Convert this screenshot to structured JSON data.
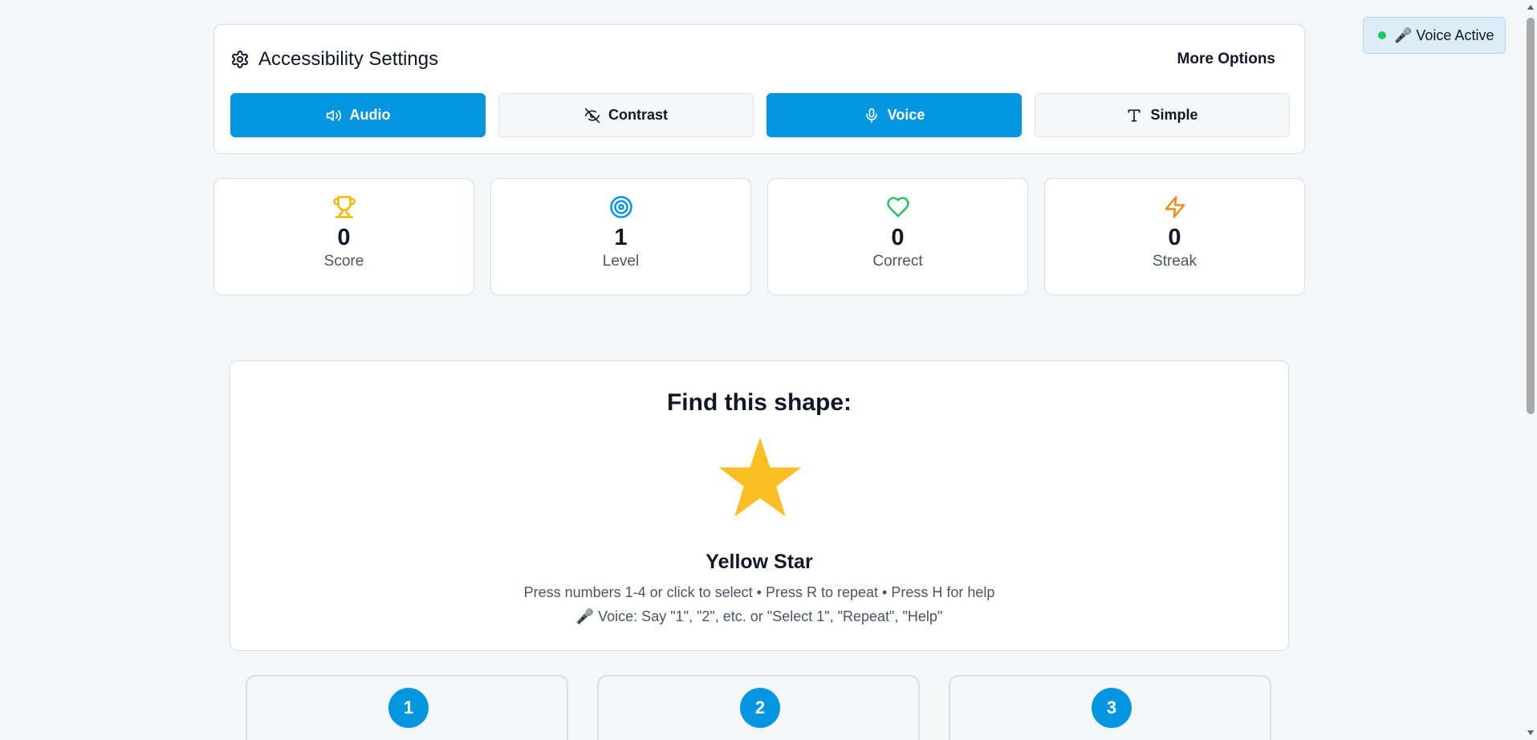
{
  "settings": {
    "title": "Accessibility Settings",
    "more_options": "More Options",
    "toggles": [
      {
        "label": "Audio",
        "icon": "speaker-icon",
        "active": true
      },
      {
        "label": "Contrast",
        "icon": "eye-off-icon",
        "active": false
      },
      {
        "label": "Voice",
        "icon": "microphone-icon",
        "active": true
      },
      {
        "label": "Simple",
        "icon": "text-icon",
        "active": false
      }
    ]
  },
  "stats": [
    {
      "value": "0",
      "label": "Score",
      "icon": "trophy-icon",
      "color": "#f5b800"
    },
    {
      "value": "1",
      "label": "Level",
      "icon": "target-icon",
      "color": "#0596e2"
    },
    {
      "value": "0",
      "label": "Correct",
      "icon": "heart-icon",
      "color": "#22c55e"
    },
    {
      "value": "0",
      "label": "Streak",
      "icon": "lightning-icon",
      "color": "#f08c1a"
    }
  ],
  "game": {
    "prompt": "Find this shape:",
    "target_shape": "star",
    "target_color": "#fbbf24",
    "shape_name": "Yellow Star",
    "hint_keyboard": "Press numbers 1-4 or click to select • Press R to repeat • Press H for help",
    "hint_voice": "🎤 Voice: Say \"1\", \"2\", etc. or \"Select 1\", \"Repeat\", \"Help\""
  },
  "options": [
    {
      "number": "1"
    },
    {
      "number": "2"
    },
    {
      "number": "3"
    }
  ],
  "voice_badge": {
    "label": "🎤 Voice Active",
    "dot_color": "#22c55e"
  },
  "colors": {
    "accent": "#0596e2",
    "background": "#f4f6f8"
  }
}
